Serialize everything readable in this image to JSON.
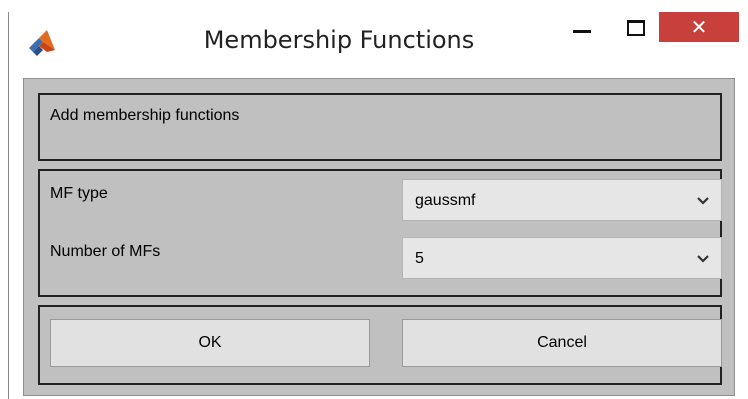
{
  "window": {
    "title": "Membership Functions",
    "icon": "matlab-icon",
    "controls": {
      "minimize_icon": "minimize-icon",
      "maximize_icon": "maximize-icon",
      "close_icon": "close-icon",
      "close_glyph": "✕",
      "close_color": "#c7403b"
    }
  },
  "header_panel": {
    "text": "Add membership functions"
  },
  "params_panel": {
    "mf_type": {
      "label": "MF type",
      "value": "gaussmf",
      "icon": "chevron-down-icon"
    },
    "num_mfs": {
      "label": "Number of MFs",
      "value": "5",
      "icon": "chevron-down-icon"
    }
  },
  "buttons": {
    "ok_label": "OK",
    "cancel_label": "Cancel"
  },
  "colors": {
    "dialog_background": "#c0c0c0",
    "control_background": "#e1e1e1"
  }
}
